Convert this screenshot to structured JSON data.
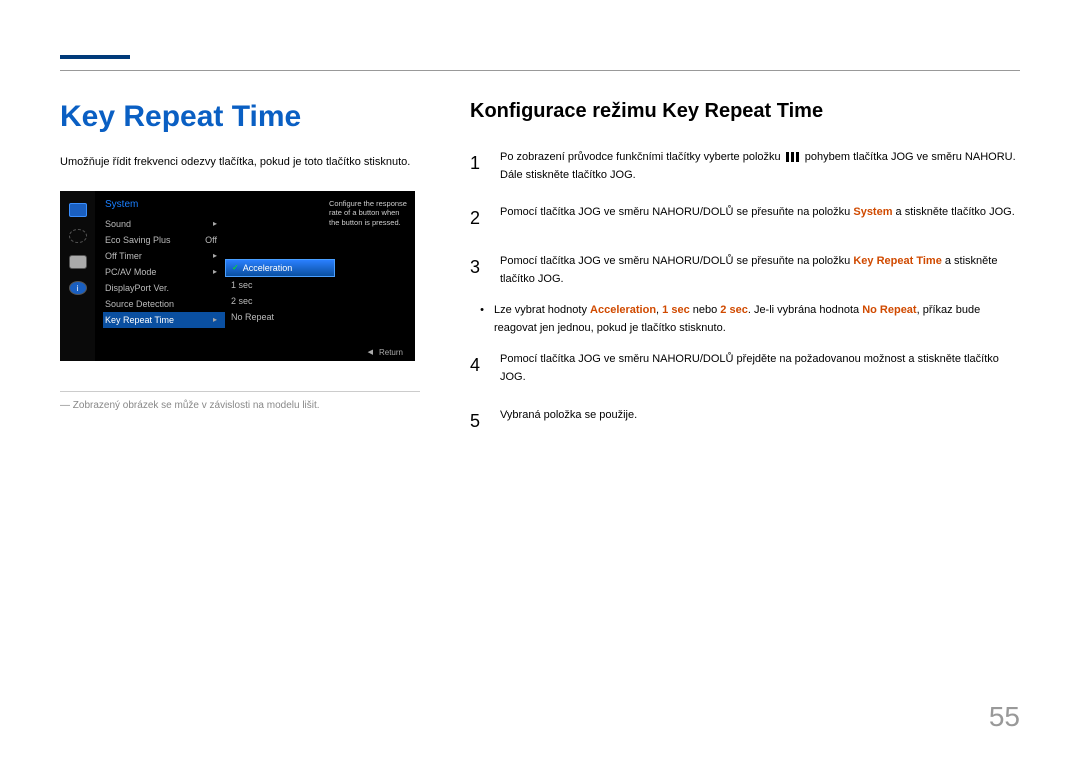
{
  "mainTitle": "Key Repeat Time",
  "intro": "Umožňuje řídit frekvenci odezvy tlačítka, pokud je toto tlačítko stisknuto.",
  "osd": {
    "header": "System",
    "items": {
      "sound": "Sound",
      "eco": "Eco Saving Plus",
      "ecoVal": "Off",
      "offtimer": "Off Timer",
      "pcav": "PC/AV Mode",
      "dpver": "DisplayPort Ver.",
      "srcdet": "Source Detection",
      "krt": "Key Repeat Time"
    },
    "sub": {
      "accel": "Acceleration",
      "s1": "1 sec",
      "s2": "2 sec",
      "norep": "No Repeat"
    },
    "desc": "Configure the response rate of a button when the button is pressed.",
    "return": "Return"
  },
  "footnote": "―  Zobrazený obrázek se může v závislosti na modelu lišit.",
  "subTitle": "Konfigurace režimu Key Repeat Time",
  "s1": {
    "num": "1",
    "a": "Po zobrazení průvodce funkčními tlačítky vyberte položku ",
    "b": " pohybem tlačítka JOG ve směru NAHORU. Dále stiskněte tlačítko JOG."
  },
  "s2": {
    "num": "2",
    "a": "Pomocí tlačítka JOG ve směru NAHORU/DOLŮ se přesuňte na položku ",
    "hl": "System",
    "b": " a stiskněte tlačítko JOG."
  },
  "s3": {
    "num": "3",
    "a": "Pomocí tlačítka JOG ve směru NAHORU/DOLŮ se přesuňte na položku ",
    "hl": "Key Repeat Time",
    "b": " a stiskněte tlačítko JOG."
  },
  "bl": {
    "a": "Lze vybrat hodnoty ",
    "accel": "Acceleration",
    "c1": ", ",
    "s1": "1 sec",
    "c2": " nebo ",
    "s2": "2 sec",
    "c3": ". Je-li vybrána hodnota ",
    "nr": "No Repeat",
    "d": ", příkaz bude reagovat jen jednou, pokud je tlačítko stisknuto."
  },
  "s4": {
    "num": "4",
    "t": "Pomocí tlačítka JOG ve směru NAHORU/DOLŮ přejděte na požadovanou možnost a stiskněte tlačítko JOG."
  },
  "s5": {
    "num": "5",
    "t": "Vybraná položka se použije."
  },
  "pageNum": "55"
}
